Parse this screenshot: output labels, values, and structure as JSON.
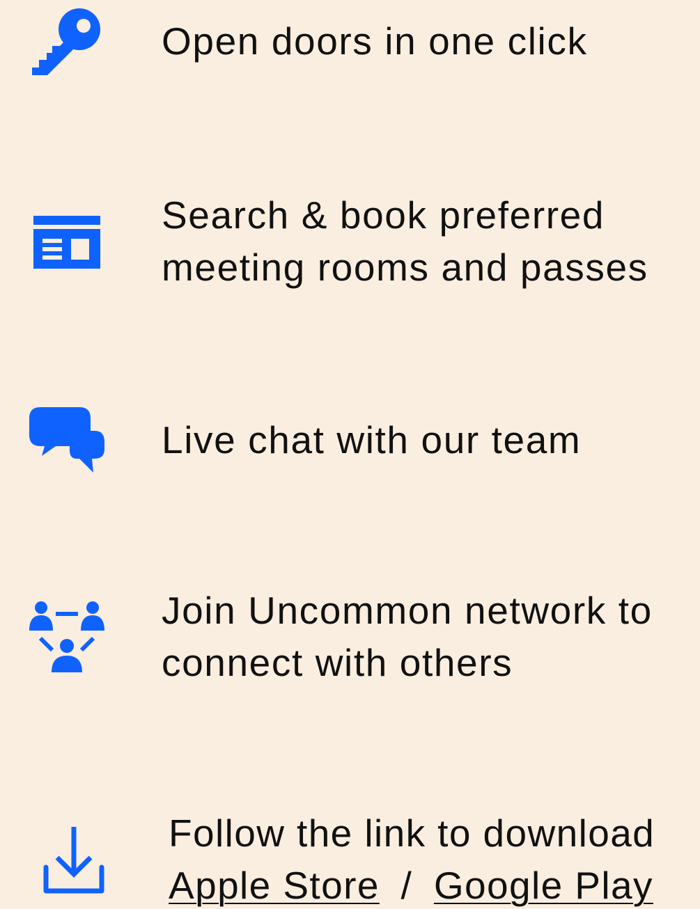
{
  "accent_color": "#0f62fe",
  "background_color": "#faeee0",
  "features": [
    {
      "icon": "key-icon",
      "lines": [
        "Open doors in one click"
      ]
    },
    {
      "icon": "booking-card-icon",
      "lines": [
        "Search & book preferred",
        "meeting rooms and passes"
      ]
    },
    {
      "icon": "chat-bubbles-icon",
      "lines": [
        "Live chat with our team"
      ]
    },
    {
      "icon": "network-people-icon",
      "lines": [
        "Join Uncommon network to",
        "connect with others"
      ]
    }
  ],
  "download": {
    "icon": "download-icon",
    "text": "Follow the link to download",
    "apple_store_label": "Apple Store",
    "separator": "/",
    "google_play_label": "Google Play"
  }
}
